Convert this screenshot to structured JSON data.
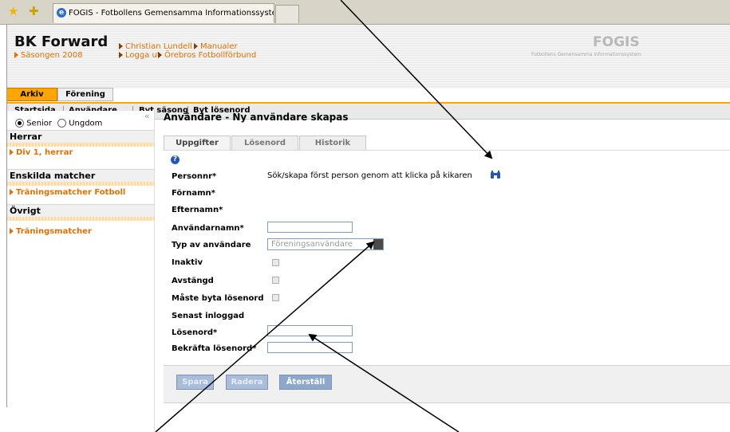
{
  "browser": {
    "tab_title": "FOGIS - Fotbollens Gemensamma Informationssystem",
    "tab_icon": "ie-icon"
  },
  "header": {
    "org_name": "BK Forward",
    "season": "Säsongen 2008",
    "links": [
      "Christian Lundell",
      "Manualer",
      "Logga ut",
      "Örebros Fotbollförbund"
    ],
    "brand": "FOGIS",
    "brand_sub": "Fotbollens Gemensamma Informationssystem"
  },
  "nav": {
    "tabs": [
      "Arkiv",
      "Förening"
    ],
    "active_tab": "Arkiv",
    "menu": [
      "Startsida",
      "Användare",
      "Byt säsong",
      "Byt lösenord"
    ]
  },
  "sidebar": {
    "radios": [
      {
        "label": "Senior",
        "checked": true
      },
      {
        "label": "Ungdom",
        "checked": false
      }
    ],
    "collapse_glyph": "«",
    "sections": [
      {
        "title": "Herrar",
        "items": [
          "Div 1, herrar"
        ]
      },
      {
        "title": "Enskilda matcher",
        "items": [
          "Träningsmatcher Fotboll"
        ]
      },
      {
        "title": "Övrigt",
        "items": [
          "Träningsmatcher"
        ]
      }
    ]
  },
  "main": {
    "title": "Användare - Ny användare skapas",
    "tabs": [
      "Uppgifter",
      "Lösenord",
      "Historik"
    ],
    "active_tab": "Uppgifter",
    "search_hint": "Sök/skapa först person genom att klicka på kikaren",
    "fields": {
      "personnr": "Personnr*",
      "fornamn": "Förnamn*",
      "efternamn": "Efternamn*",
      "anvandarnamn": "Användarnamn*",
      "typ": "Typ av användare",
      "inaktiv": "Inaktiv",
      "avstangd": "Avstängd",
      "maste_byta": "Måste byta lösenord",
      "senast_inloggad": "Senast inloggad",
      "losenord": "Lösenord*",
      "bekrafta": "Bekräfta lösenord*"
    },
    "type_value": "Föreningsanvändare",
    "buttons": [
      "Spara",
      "Radera",
      "Återställ"
    ]
  },
  "colors": {
    "accent": "#ffa500",
    "link": "#e07000",
    "button": "#8ea8cc"
  }
}
